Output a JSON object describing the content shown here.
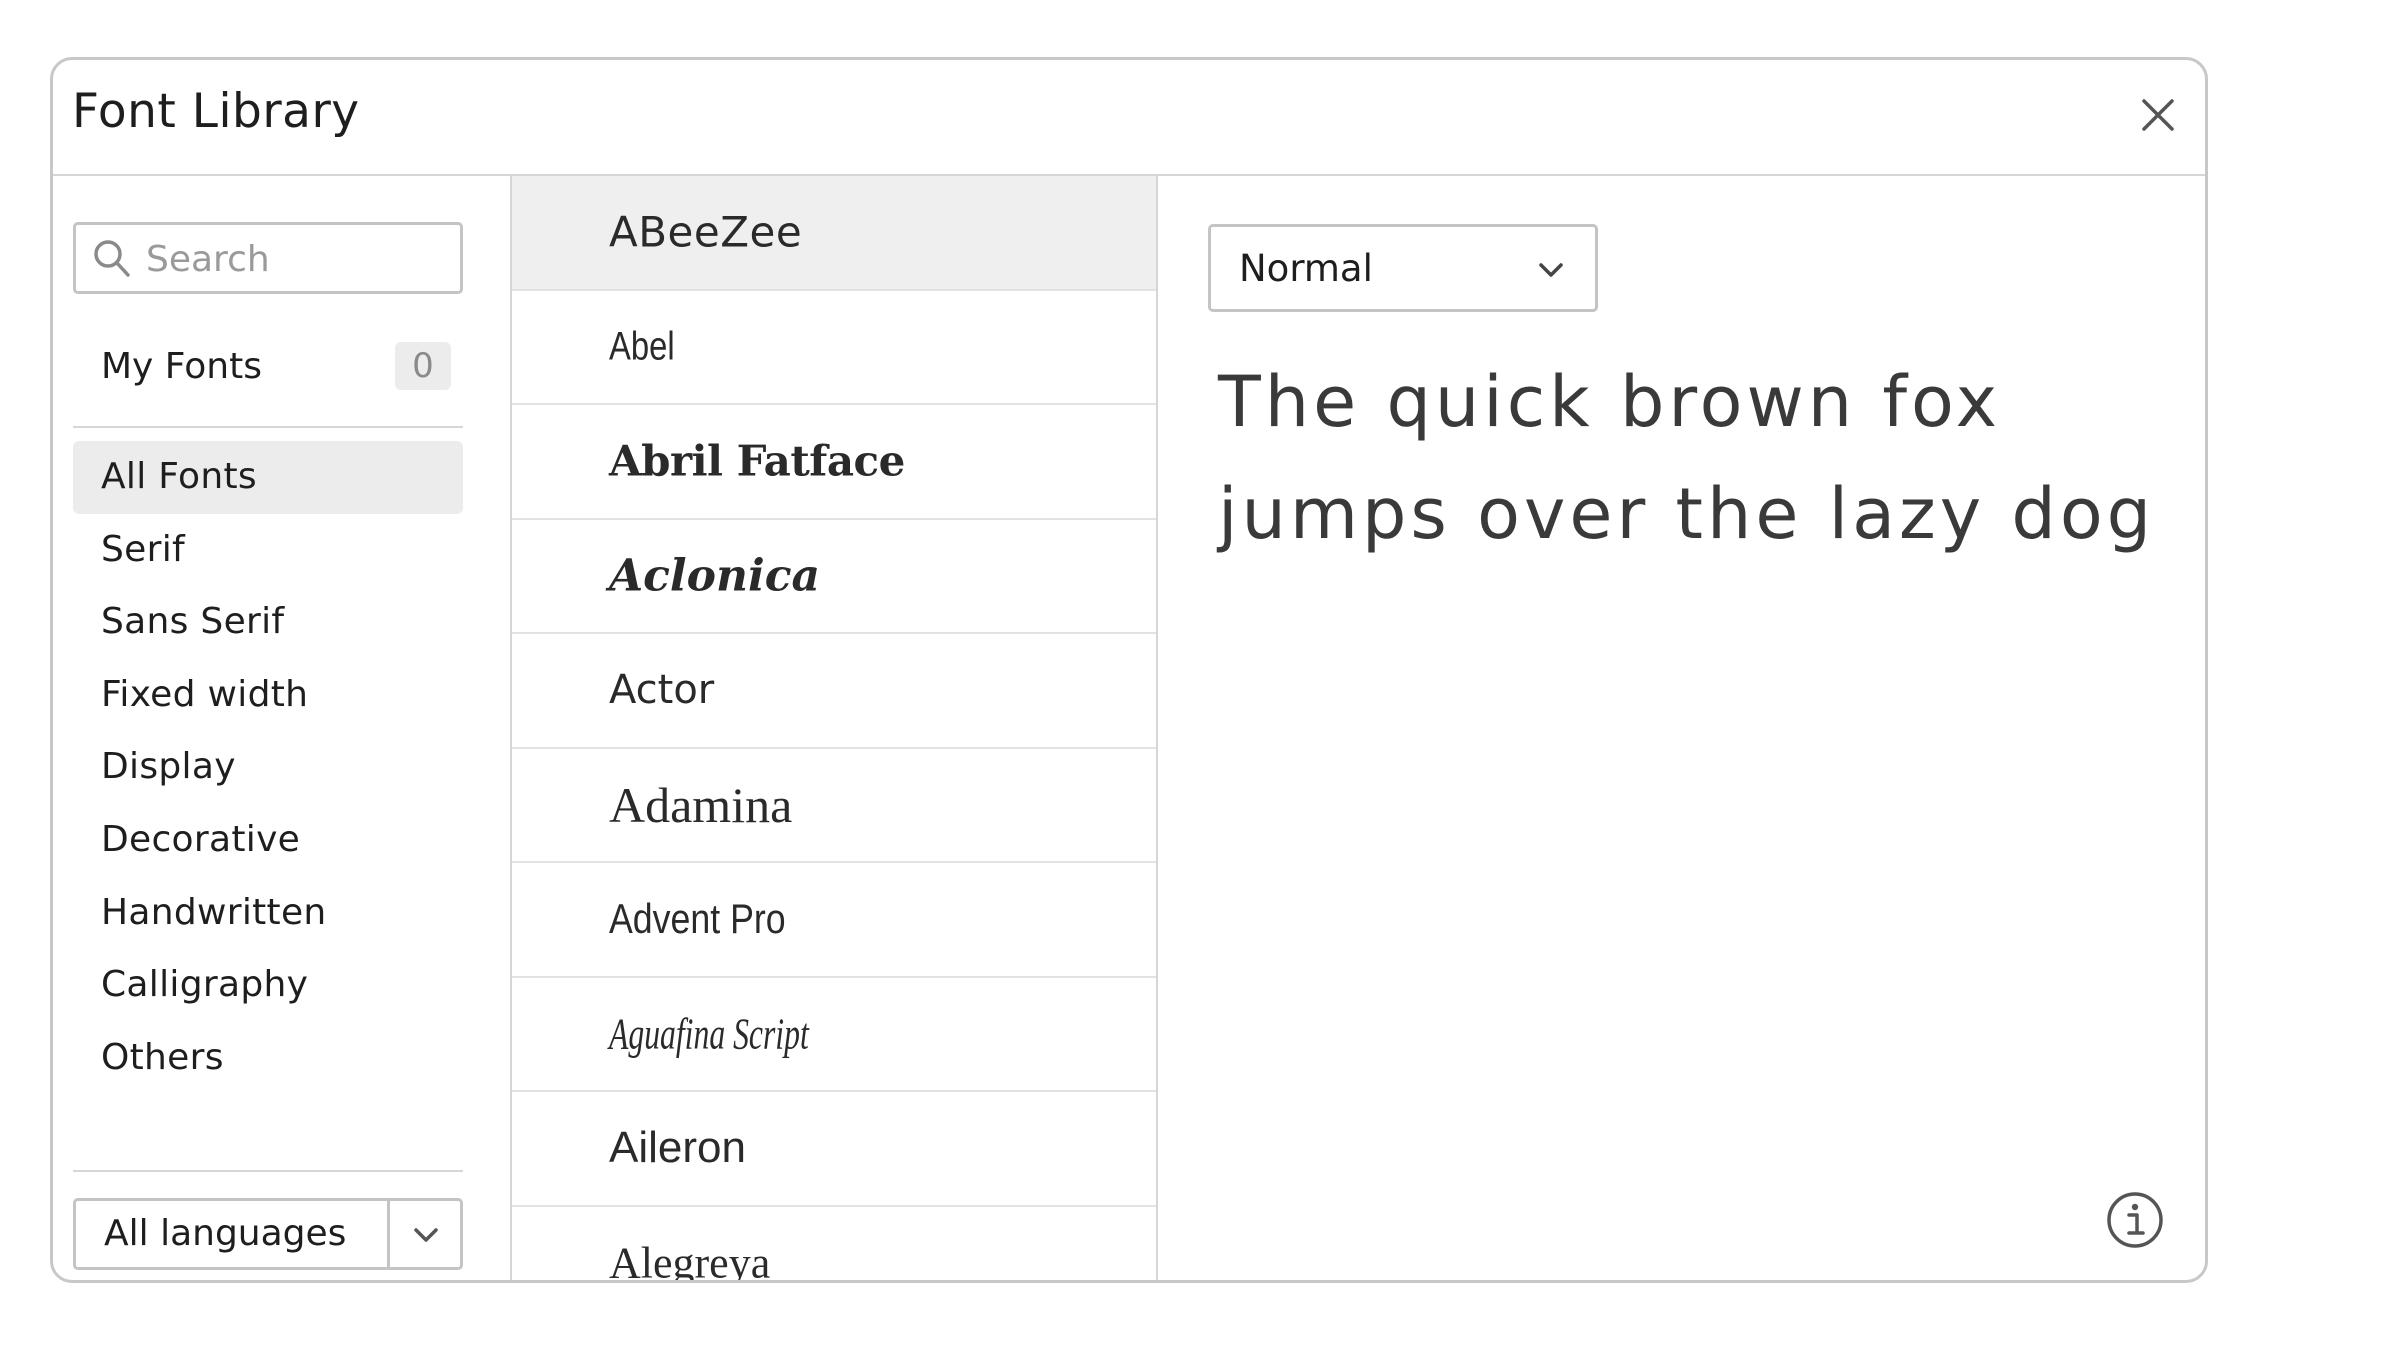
{
  "dialog": {
    "title": "Font Library",
    "close_icon": "close-icon"
  },
  "sidebar": {
    "search": {
      "placeholder": "Search",
      "value": "",
      "icon": "search-icon"
    },
    "my_fonts": {
      "label": "My Fonts",
      "count": "0"
    },
    "categories": [
      {
        "label": "All Fonts",
        "active": true
      },
      {
        "label": "Serif"
      },
      {
        "label": "Sans Serif"
      },
      {
        "label": "Fixed width"
      },
      {
        "label": "Display"
      },
      {
        "label": "Decorative"
      },
      {
        "label": "Handwritten"
      },
      {
        "label": "Calligraphy"
      },
      {
        "label": "Others"
      }
    ],
    "language_select": {
      "value": "All languages",
      "icon": "chevron-down-icon"
    }
  },
  "font_list": {
    "selected_index": 0,
    "items": [
      {
        "label": "ABeeZee"
      },
      {
        "label": "Abel"
      },
      {
        "label": "Abril Fatface"
      },
      {
        "label": "Aclonica"
      },
      {
        "label": "Actor"
      },
      {
        "label": "Adamina"
      },
      {
        "label": "Advent Pro"
      },
      {
        "label": "Aguafina Script"
      },
      {
        "label": "Aileron"
      },
      {
        "label": "Alegreya"
      }
    ]
  },
  "preview": {
    "style_select": {
      "value": "Normal",
      "icon": "chevron-down-icon"
    },
    "sample_text": "The quick brown fox jumps over the lazy dog",
    "info_icon": "info-icon"
  },
  "colors": {
    "border": "#c4c4c4",
    "selected_bg": "#efefef",
    "text": "#1e1e1e",
    "badge_bg": "#ececec"
  }
}
